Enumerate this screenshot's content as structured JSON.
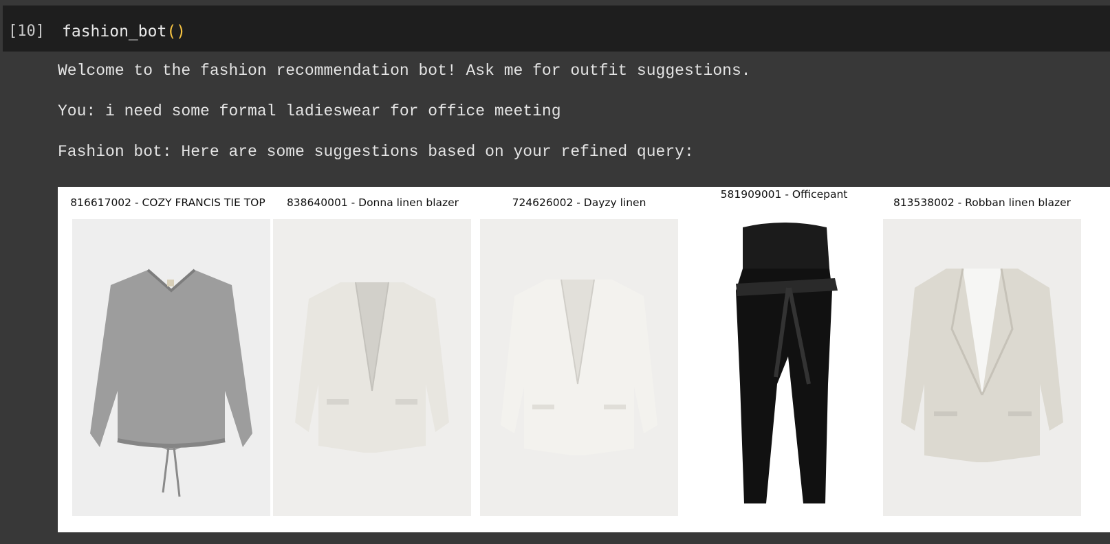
{
  "cell": {
    "execution_count": "[10]",
    "code_name": "fashion_bot",
    "code_parens": "()"
  },
  "output": {
    "welcome": "Welcome to the fashion recommendation bot! Ask me for outfit suggestions.",
    "user_message": "You: i need some formal ladieswear for office meeting",
    "bot_message": "Fashion bot: Here are some suggestions based on your refined query:"
  },
  "products": [
    {
      "title": "816617002 - COZY FRANCIS TIE TOP",
      "image": "grey-knit-tie-top-image"
    },
    {
      "title": "838640001 - Donna linen blazer",
      "image": "white-linen-blazer-image"
    },
    {
      "title": "724626002 - Dayzy linen",
      "image": "white-linen-jacket-image"
    },
    {
      "title": "581909001 - Officepant",
      "image": "black-maternity-pants-image"
    },
    {
      "title": "813538002 - Robban linen blazer",
      "image": "beige-linen-blazer-image"
    }
  ],
  "colors": {
    "notebook_bg": "#383838",
    "input_bg": "#1e1e1e",
    "paren": "#f6c342",
    "text": "#e4e4e4"
  }
}
